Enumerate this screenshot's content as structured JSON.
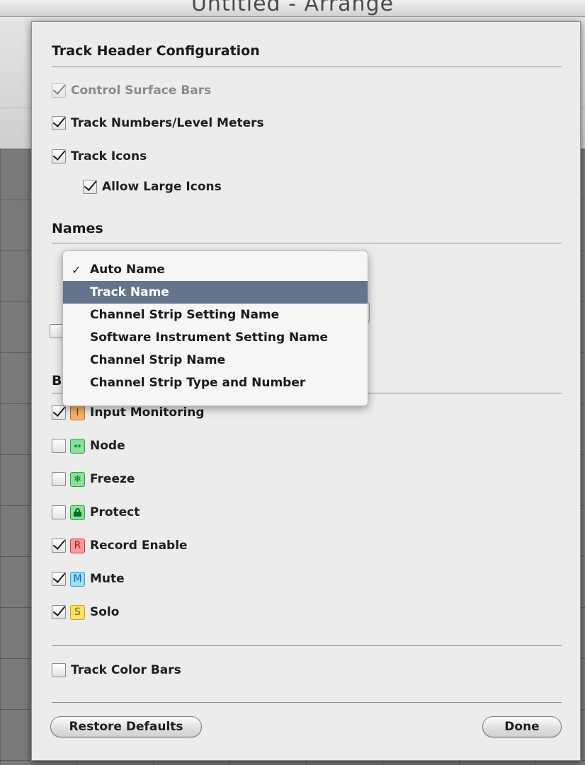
{
  "window": {
    "title": "Untitled - Arrange"
  },
  "sections": {
    "track_header": "Track Header Configuration",
    "names": "Names",
    "buttons_letter": "B"
  },
  "header_options": {
    "control_surface_bars": {
      "label": "Control Surface Bars",
      "checked": true,
      "disabled": true
    },
    "track_numbers": {
      "label": "Track Numbers/Level Meters",
      "checked": true
    },
    "track_icons": {
      "label": "Track Icons",
      "checked": true
    },
    "allow_large_icons": {
      "label": "Allow Large Icons",
      "checked": true
    }
  },
  "names_menu": {
    "items": [
      {
        "label": "Auto Name",
        "checked": true
      },
      {
        "label": "Track Name",
        "highlighted": true
      },
      {
        "label": "Channel Strip Setting Name"
      },
      {
        "label": "Software Instrument Setting Name"
      },
      {
        "label": "Channel Strip Name"
      },
      {
        "label": "Channel Strip Type and Number"
      }
    ],
    "checkmark": "✓"
  },
  "buttons_options": [
    {
      "label": "Input Monitoring",
      "icon_letter": "I",
      "icon": "input-monitoring-icon",
      "checked": true
    },
    {
      "label": "Node",
      "icon_letter": "↔",
      "icon": "node-icon",
      "checked": false
    },
    {
      "label": "Freeze",
      "icon_letter": "❄",
      "icon": "freeze-icon",
      "checked": false
    },
    {
      "label": "Protect",
      "icon_letter": "",
      "icon": "lock-icon",
      "checked": false
    },
    {
      "label": "Record Enable",
      "icon_letter": "R",
      "icon": "record-icon",
      "checked": true
    },
    {
      "label": "Mute",
      "icon_letter": "M",
      "icon": "mute-icon",
      "checked": true
    },
    {
      "label": "Solo",
      "icon_letter": "S",
      "icon": "solo-icon",
      "checked": true
    }
  ],
  "track_color_bars": {
    "label": "Track Color Bars",
    "checked": false
  },
  "footer": {
    "restore_defaults": "Restore Defaults",
    "done": "Done"
  },
  "colors": {
    "menu_highlight": "#64748c",
    "sheet_background": "#ececec"
  }
}
